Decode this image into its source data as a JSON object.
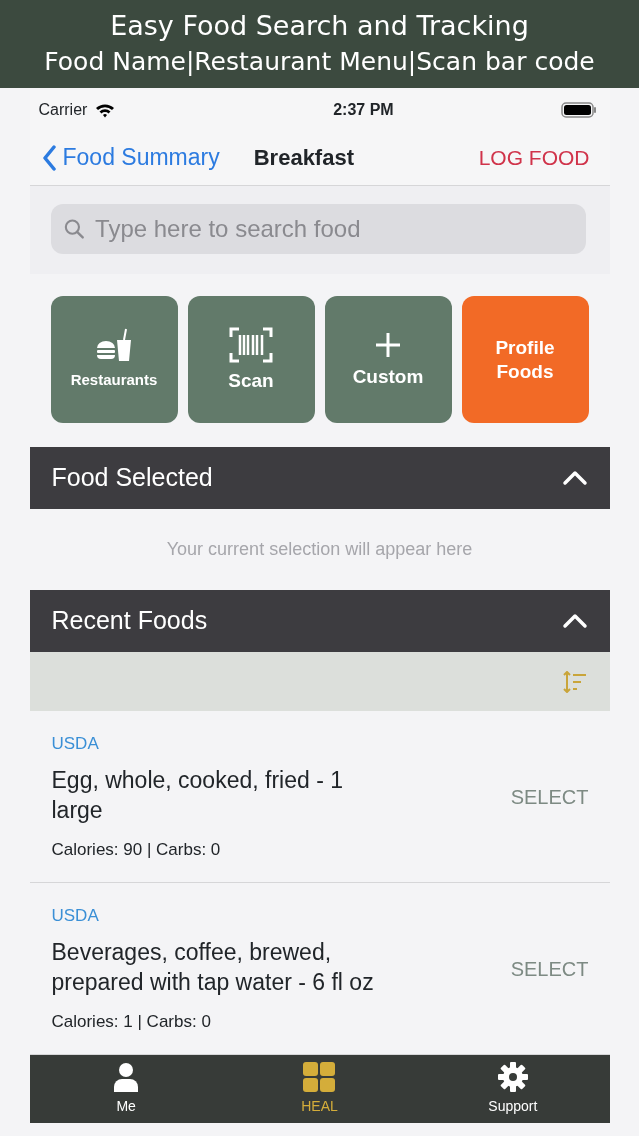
{
  "banner": {
    "lines": [
      "Easy Food Search and Tracking",
      "Food Name|Restaurant Menu|Scan bar code"
    ]
  },
  "status_bar": {
    "carrier": "Carrier",
    "time": "2:37 PM"
  },
  "nav": {
    "back": "Food Summary",
    "title": "Breakfast",
    "action": "LOG FOOD"
  },
  "search": {
    "placeholder": "Type here to search food"
  },
  "quick_buttons": [
    {
      "kind": "restaurants",
      "label": "Restaurants",
      "color": "#627a6a"
    },
    {
      "kind": "scan",
      "label": "Scan",
      "color": "#627a6a"
    },
    {
      "kind": "custom",
      "label": "Custom",
      "color": "#627a6a"
    },
    {
      "kind": "text",
      "label": "Profile Foods",
      "color": "#f26a26"
    }
  ],
  "food_selected": {
    "title": "Food Selected",
    "expanded": true,
    "empty_text": "Your current selection will appear here"
  },
  "recent_foods": {
    "title": "Recent Foods",
    "expanded": true,
    "items": [
      {
        "source": "USDA",
        "name": "Egg, whole, cooked, fried - 1 large",
        "info": "Calories: 90 | Carbs: 0",
        "action": "SELECT"
      },
      {
        "source": "USDA",
        "name": "Beverages, coffee, brewed, prepared with tap water - 6 fl oz",
        "info": "Calories: 1 | Carbs: 0",
        "action": "SELECT"
      }
    ]
  },
  "tab_bar": [
    {
      "kind": "person",
      "label": "Me",
      "selected": false
    },
    {
      "kind": "grid",
      "label": "HEAL",
      "selected": true
    },
    {
      "kind": "gear",
      "label": "Support",
      "selected": false
    }
  ]
}
